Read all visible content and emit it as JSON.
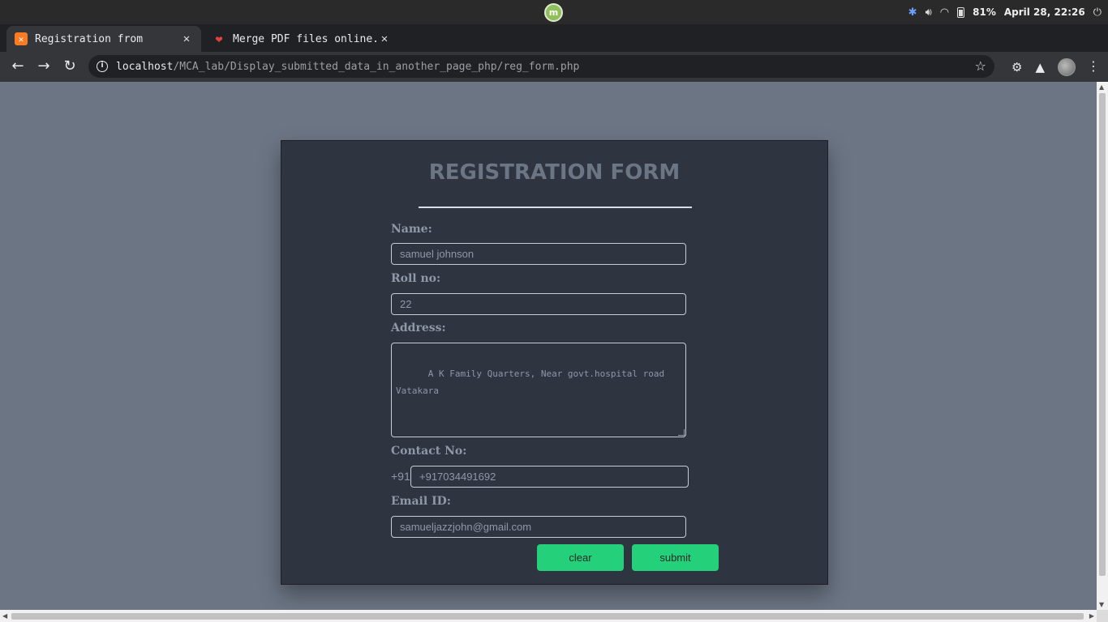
{
  "os": {
    "logo": "m",
    "battery": "81%",
    "datetime": "April 28, 22:26",
    "icons": [
      "bluetooth-icon",
      "volume-icon",
      "wifi-icon",
      "battery-icon",
      "power-icon"
    ]
  },
  "browser": {
    "tabs": [
      {
        "title": "Registration from",
        "favicon": "xampp-icon",
        "active": true
      },
      {
        "title": "Merge PDF files online.",
        "favicon": "heart-icon",
        "active": false
      }
    ],
    "url_host": "localhost",
    "url_path": "/MCA_lab/Display_submitted_data_in_another_page_php/reg_form.php"
  },
  "form": {
    "title": "REGISTRATION FORM",
    "name_label": "Name:",
    "name_value": "samuel johnson",
    "roll_label": "Roll no:",
    "roll_value": "22",
    "address_label": "Address:",
    "address_value": "A K Family Quarters, Near govt.hospital road\nVatakara",
    "contact_label": "Contact No:",
    "contact_prefix": "+91",
    "contact_value": "+917034491692",
    "email_label": "Email ID:",
    "email_value": "samueljazzjohn@gmail.com",
    "clear_label": "clear",
    "submit_label": "submit"
  },
  "colors": {
    "page_bg": "#6b7584",
    "card_bg": "#2e3440",
    "button": "#24d07a",
    "label": "#8e98a6"
  }
}
